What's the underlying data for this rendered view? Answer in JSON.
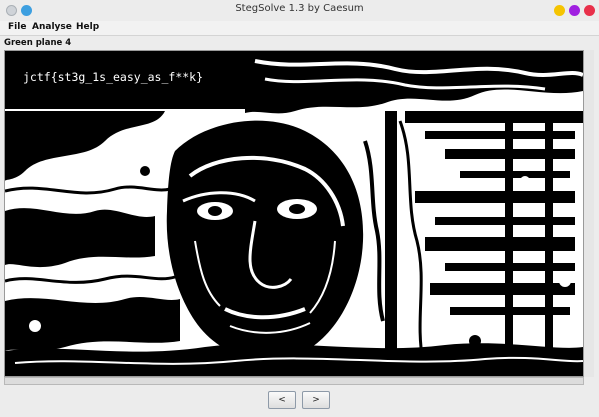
{
  "window": {
    "title": "StegSolve 1.3 by Caesum"
  },
  "menu": {
    "file": "File",
    "analyse": "Analyse",
    "help": "Help"
  },
  "viewer": {
    "plane_label": "Green plane 4",
    "flag_text": "jctf{st3g_1s_easy_as_f**k}"
  },
  "nav": {
    "prev_label": "<",
    "next_label": ">"
  },
  "colors": {
    "window_bg": "#ececec",
    "image_fg": "#000000",
    "image_bg": "#ffffff",
    "dot_blue": "#3d9fe0",
    "dot_minimize": "#f5c400",
    "dot_maximize": "#a020e0",
    "dot_close": "#e8304a"
  }
}
